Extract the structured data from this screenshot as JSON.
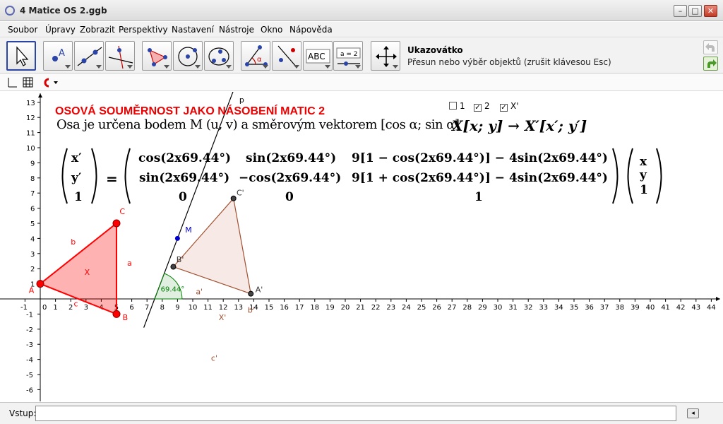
{
  "window": {
    "title": "4 Matice OS 2.ggb"
  },
  "menu": [
    "Soubor",
    "Úpravy",
    "Zobrazit",
    "Perspektivy",
    "Nastavení",
    "Nástroje",
    "Okno",
    "Nápověda"
  ],
  "toolbar": {
    "tools": [
      "move-tool",
      "point-tool",
      "line-tool",
      "perpendicular-line-tool",
      "polygon-tool",
      "circle-center-point-tool",
      "circle-three-points-tool",
      "angle-tool",
      "reflect-about-line-tool",
      "text-tool",
      "slider-tool",
      "move-graphics-view-tool"
    ],
    "text_tool_label": "ABC",
    "slider_tool_label": "a = 2",
    "active_tool_name": "Ukazovátko",
    "active_tool_help": "Přesun nebo výběr objektů (zrušit klávesou Esc)"
  },
  "graphics": {
    "title": "OSOVÁ SOUMĚRNOST JAKO NÁSOBENÍ MATIC 2",
    "subtitle": "Osa je určena bodem M (u, v) a směrovým vektorem [cos α; sin α]",
    "mapping": "X[x; y] → X′[x′; y′]",
    "checkboxes": [
      {
        "label": "1",
        "checked": false
      },
      {
        "label": "2",
        "checked": true
      },
      {
        "label": "X'",
        "checked": true
      }
    ],
    "matrix": {
      "left_vector": [
        "x′",
        "y′",
        "1"
      ],
      "equals": "=",
      "row1": [
        "cos(2x69.44°)",
        "sin(2x69.44°)",
        "9[1 − cos(2x69.44°)] − 4sin(2x69.44°)"
      ],
      "row2": [
        "sin(2x69.44°)",
        "−cos(2x69.44°)",
        "9[1 + cos(2x69.44°)] − 4sin(2x69.44°)"
      ],
      "row3": [
        "0",
        "0",
        "1"
      ],
      "right_vector": [
        "x",
        "y",
        "1"
      ]
    },
    "x_ticks": [
      "-1",
      "0",
      "1",
      "2",
      "3",
      "4",
      "5",
      "6",
      "7",
      "8",
      "9",
      "10",
      "11",
      "12",
      "13",
      "14",
      "15",
      "16",
      "17",
      "18",
      "19",
      "20",
      "21",
      "22",
      "23",
      "24",
      "25",
      "26",
      "27",
      "28",
      "29",
      "30",
      "31",
      "32",
      "33",
      "34",
      "35",
      "36",
      "37",
      "38",
      "39",
      "40",
      "41",
      "42",
      "43",
      "44"
    ],
    "y_ticks": [
      "13",
      "12",
      "11",
      "10",
      "9",
      "8",
      "7",
      "6",
      "5",
      "4",
      "3",
      "2",
      "1",
      "-1",
      "-2",
      "-3",
      "-4",
      "-5",
      "-6"
    ],
    "labels": {
      "A": "A",
      "B": "B",
      "C": "C",
      "a": "a",
      "b": "b",
      "c": "c",
      "X": "X",
      "A2": "A'",
      "B2": "B'",
      "C2": "C'",
      "a2": "a'",
      "b2": "b'",
      "c2": "c'",
      "X2": "X'",
      "M": "M",
      "p": "p",
      "angle": "69.44°"
    },
    "colors": {
      "original": "#ff0000",
      "image": "#a05030",
      "axis_line": "#000000",
      "angle": "#007f00",
      "point_m": "#0000cc"
    }
  },
  "input": {
    "label": "Vstup:",
    "value": ""
  }
}
